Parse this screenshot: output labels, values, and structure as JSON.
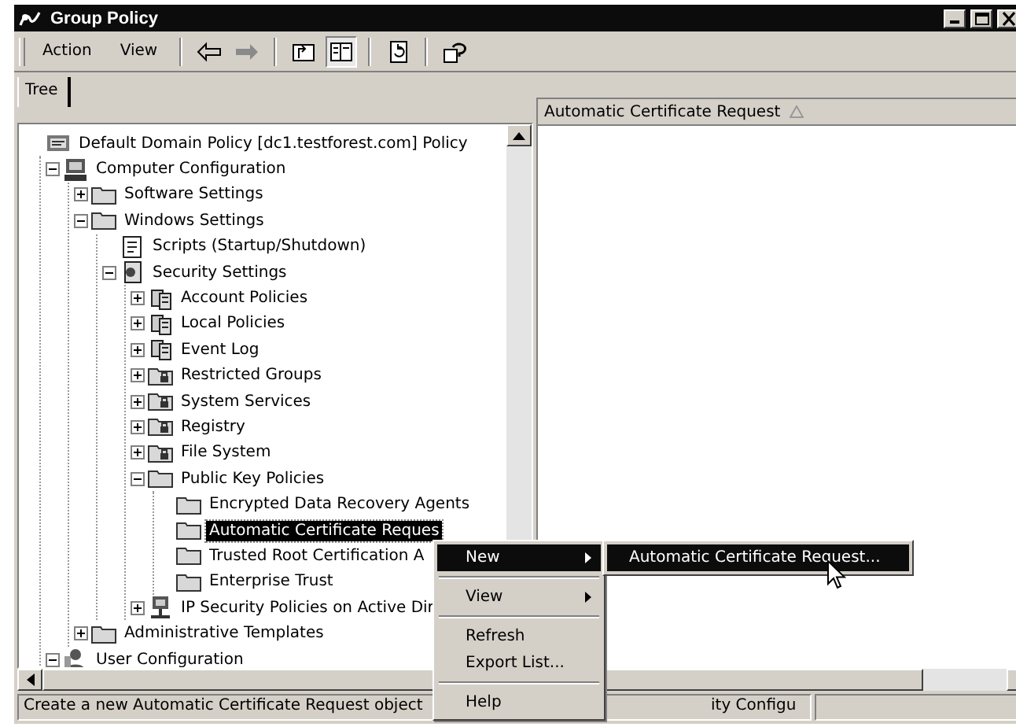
{
  "window": {
    "title": "Group Policy"
  },
  "menu_bar": [
    {
      "label": "Action"
    },
    {
      "label": "View"
    }
  ],
  "toolbar": [
    {
      "kind": "back",
      "disabled": false,
      "pressed": false
    },
    {
      "kind": "forward",
      "disabled": true,
      "pressed": false
    },
    {
      "kind": "up",
      "disabled": false,
      "pressed": false
    },
    {
      "kind": "tree",
      "disabled": false,
      "pressed": true
    },
    {
      "kind": "export",
      "disabled": false,
      "pressed": false
    },
    {
      "kind": "help",
      "disabled": false,
      "pressed": false
    }
  ],
  "tree_tab": {
    "label": "Tree"
  },
  "tree": [
    {
      "label": "Default Domain Policy [dc1.testforest.com] Policy",
      "kind": "policy",
      "selected": false,
      "children": [
        {
          "label": "Computer Configuration",
          "kind": "computer",
          "selected": false,
          "expanded": true,
          "children": [
            {
              "label": "Software Settings",
              "kind": "folder",
              "selected": false,
              "expanded": false
            },
            {
              "label": "Windows Settings",
              "kind": "folder",
              "selected": false,
              "expanded": true,
              "children": [
                {
                  "label": "Scripts (Startup/Shutdown)",
                  "kind": "script",
                  "selected": false
                },
                {
                  "label": "Security Settings",
                  "kind": "security",
                  "selected": false,
                  "expanded": true,
                  "children": [
                    {
                      "label": "Account Policies",
                      "kind": "servers",
                      "selected": false,
                      "expanded": false
                    },
                    {
                      "label": "Local Policies",
                      "kind": "servers",
                      "selected": false,
                      "expanded": false
                    },
                    {
                      "label": "Event Log",
                      "kind": "servers",
                      "selected": false,
                      "expanded": false
                    },
                    {
                      "label": "Restricted Groups",
                      "kind": "lockfolder",
                      "selected": false,
                      "expanded": false
                    },
                    {
                      "label": "System Services",
                      "kind": "lockfolder",
                      "selected": false,
                      "expanded": false
                    },
                    {
                      "label": "Registry",
                      "kind": "lockfolder",
                      "selected": false,
                      "expanded": false
                    },
                    {
                      "label": "File System",
                      "kind": "lockfolder",
                      "selected": false,
                      "expanded": false
                    },
                    {
                      "label": "Public Key Policies",
                      "kind": "folder",
                      "selected": false,
                      "expanded": true,
                      "children": [
                        {
                          "label": "Encrypted Data Recovery Agents",
                          "kind": "folder",
                          "selected": false
                        },
                        {
                          "label": "Automatic Certificate Reques",
                          "kind": "folder",
                          "selected": true
                        },
                        {
                          "label": "Trusted Root Certification A",
                          "kind": "folder",
                          "selected": false
                        },
                        {
                          "label": "Enterprise Trust",
                          "kind": "folder",
                          "selected": false
                        }
                      ]
                    },
                    {
                      "label": "IP Security Policies on Active Dir",
                      "kind": "network",
                      "selected": false,
                      "expanded": false
                    }
                  ]
                }
              ]
            },
            {
              "label": "Administrative Templates",
              "kind": "folder",
              "selected": false,
              "expanded": false
            }
          ]
        },
        {
          "label": "User Configuration",
          "kind": "user",
          "selected": false,
          "expanded": true
        }
      ]
    }
  ],
  "details": {
    "columns": [
      {
        "label": "Automatic Certificate Request"
      }
    ]
  },
  "context_menu": [
    {
      "label": "New",
      "kind": "submenu",
      "selected": true
    },
    {
      "kind": "separator"
    },
    {
      "label": "View",
      "kind": "submenu",
      "selected": false
    },
    {
      "kind": "separator"
    },
    {
      "label": "Refresh",
      "kind": "item",
      "selected": false
    },
    {
      "label": "Export List...",
      "kind": "item",
      "selected": false
    },
    {
      "kind": "separator"
    },
    {
      "label": "Help",
      "kind": "item",
      "selected": false
    }
  ],
  "submenu": [
    {
      "label": "Automatic Certificate Request...",
      "selected": true
    }
  ],
  "status_bar": [
    {
      "text": "Create a new Automatic Certificate Request object"
    },
    {
      "text": "ity Configu"
    }
  ]
}
